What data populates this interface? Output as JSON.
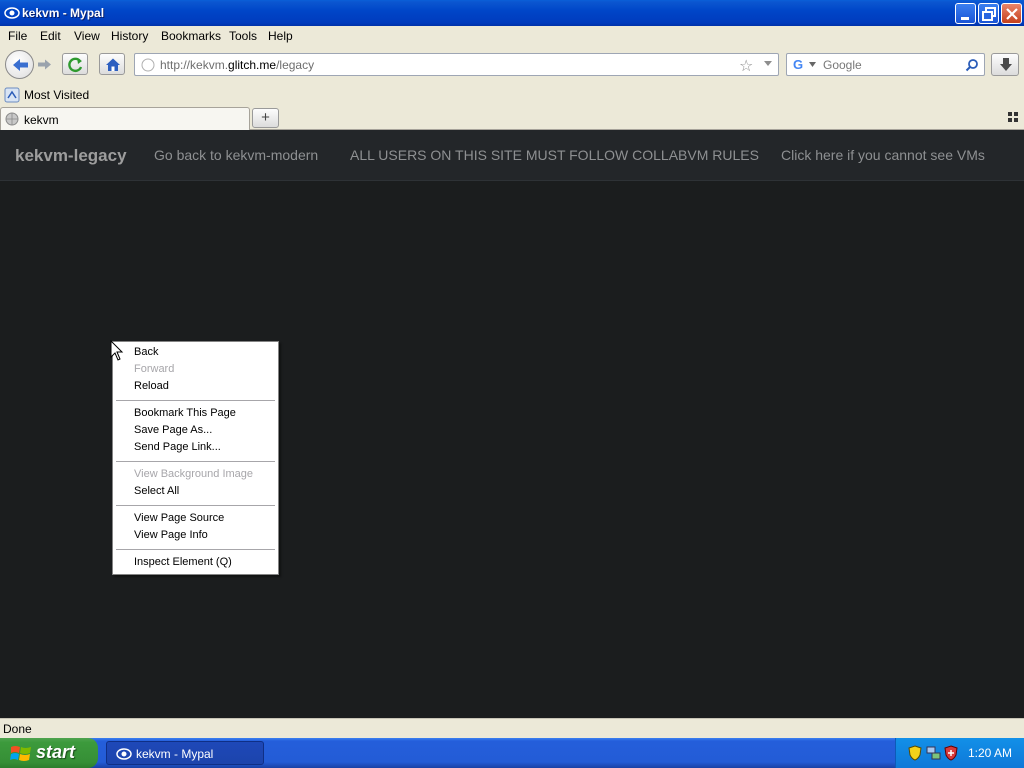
{
  "window": {
    "title": "kekvm - Mypal"
  },
  "menu": {
    "file": "File",
    "edit": "Edit",
    "view": "View",
    "history": "History",
    "bookmarks": "Bookmarks",
    "tools": "Tools",
    "help": "Help"
  },
  "nav": {
    "url_prefix": "http://kekvm.",
    "url_domain": "glitch.me",
    "url_path": "/legacy",
    "search_placeholder": "Google"
  },
  "bookmarks_bar": {
    "most_visited": "Most Visited"
  },
  "tabs": [
    {
      "label": "kekvm"
    }
  ],
  "site": {
    "brand": "kekvm-legacy",
    "links": [
      "Go back to kekvm-modern",
      "ALL USERS ON THIS SITE MUST FOLLOW COLLABVM RULES",
      "Click here if you cannot see VMs"
    ]
  },
  "context_menu": {
    "items": [
      {
        "label": "Back",
        "enabled": true
      },
      {
        "label": "Forward",
        "enabled": false
      },
      {
        "label": "Reload",
        "enabled": true
      },
      {
        "label": "Bookmark This Page",
        "enabled": true
      },
      {
        "label": "Save Page As...",
        "enabled": true
      },
      {
        "label": "Send Page Link...",
        "enabled": true
      },
      {
        "label": "View Background Image",
        "enabled": false
      },
      {
        "label": "Select All",
        "enabled": true
      },
      {
        "label": "View Page Source",
        "enabled": true
      },
      {
        "label": "View Page Info",
        "enabled": true
      },
      {
        "label": "Inspect Element (Q)",
        "enabled": true
      }
    ]
  },
  "status": {
    "text": "Done"
  },
  "taskbar": {
    "start_label": "start",
    "task_label": "kekvm - Mypal",
    "clock": "1:20 AM"
  },
  "colors": {
    "page_bg": "#1b1d1e",
    "navbar_bg": "#232629",
    "link_color": "#8e9092",
    "brand_color": "#9d9d9d"
  }
}
